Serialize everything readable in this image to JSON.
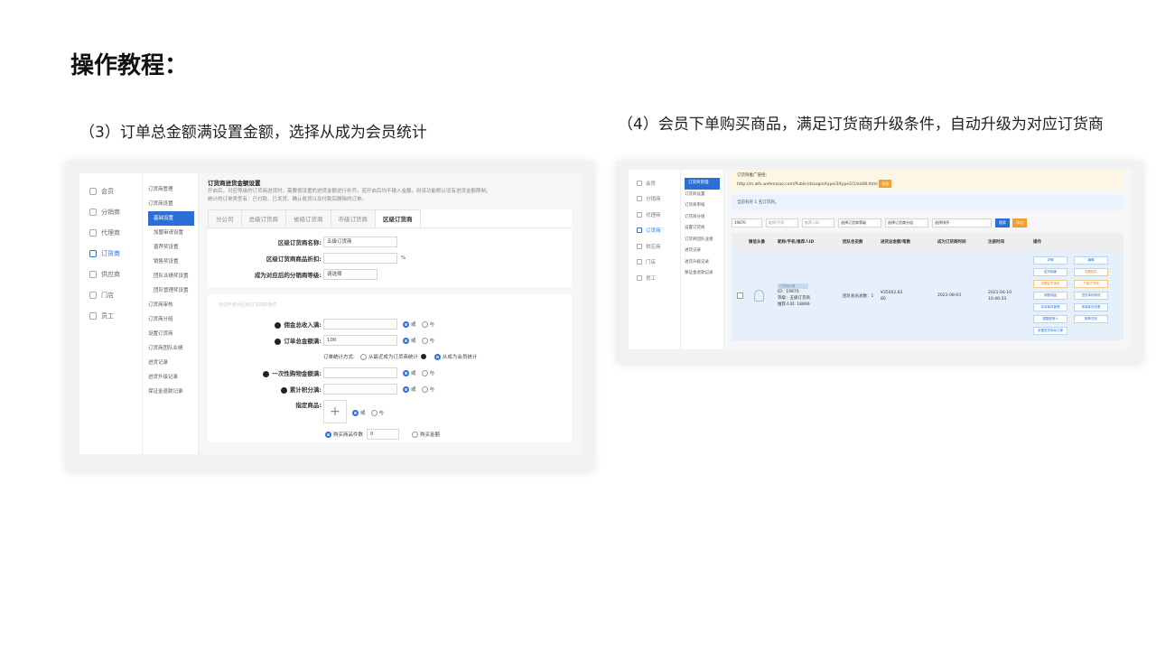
{
  "heading": "操作教程：",
  "captions": {
    "left": "（3）订单总金额满设置金额，选择从成为会员统计",
    "right": "（4）会员下单购买商品，满足订货商升级条件，自动升级为对应订货商"
  },
  "left_shot": {
    "sidebar": [
      "会员",
      "分销商",
      "代理商",
      "订货商",
      "供应商",
      "门店",
      "员工"
    ],
    "submenu": [
      "订货商管理",
      "订货商设置",
      "基础设置",
      "加盟审请设置",
      "晋荐奖设置",
      "销售奖设置",
      "团队业绩奖设置",
      "团队管理奖设置",
      "订货商审核",
      "订货商分组",
      "设置订货商",
      "订货商团队业绩",
      "进货记录",
      "进货升级记录",
      "保证金退款记录"
    ],
    "header_title": "订货商进货金额设置",
    "header_desc_1": "开启后，对应等级的订货商进货时，需要按设置的进货金额进行补齐。若开启后均不输入金额，则该功能默认没有进货金额限制。",
    "header_desc_2": "统计的订单类型有：已付款、已发货、确认收货以及付款后删除的订单。",
    "tabs": [
      "分公司",
      "总级订货商",
      "省级订货商",
      "市级订货商",
      "区级订货商"
    ],
    "fields": {
      "name_label": "区级订货商名称:",
      "name_value": "五级订货商",
      "discount_label": "区级订货商商品折扣:",
      "discount_unit": "%",
      "level_label": "成为对应后的分销商等级:",
      "level_value": "请选择",
      "faint_text": "自动升级为区级订货商的条件",
      "commission_label": "佣金总收入满:",
      "order_total_label": "订单总金额满:",
      "order_total_value": "100",
      "or": "或",
      "and": "与",
      "stat_method_label": "订单统计方式:",
      "stat_opt_1": "从最近成为订货商统计",
      "stat_opt_2": "从成为会员统计",
      "one_time_label": "一次性购物金额满:",
      "points_label": "累计积分满:",
      "goods_label": "指定商品:",
      "buy_count_label": "购买商品件数",
      "buy_count_value": "0",
      "buy_amount_label": "购买金额"
    }
  },
  "right_shot": {
    "sidebar": [
      "会员",
      "分销商",
      "代理商",
      "订货商",
      "供应商",
      "门店",
      "员工"
    ],
    "submenu": [
      "订货商管理",
      "订货商设置",
      "订货商审核",
      "订货商分组",
      "设置订货商",
      "订货商团队业绩",
      "进货记录",
      "进货升级记录",
      "保证金退款记录"
    ],
    "notice_line1": "订货商推广链接：",
    "notice_url": "http://m.wfx.wxfenxiao.com/Public/dsLogin/type/3/type2/1/aid/8.html",
    "notice_btn": "复制",
    "count_text": "当前有符 1 名订货商。",
    "filters": [
      "19870",
      "昵称/手机",
      "推荐人ID",
      "选择订货商等级",
      "选择订货商分组",
      "选择排序"
    ],
    "search_btn": "搜索",
    "export_btn": "导出",
    "columns": [
      "微信头像",
      "昵称/手机/推荐人ID",
      "团队会员数",
      "进货总金额/笔数",
      "成为订货商时间",
      "注册时间",
      "操作"
    ],
    "row": {
      "tag": "订货商分组",
      "id": "ID：19870",
      "level": "等级：五级订货商",
      "referrer": "推荐人ID: 18896",
      "team": "团队会员总数：1",
      "amount": "¥35002.62",
      "count": "80",
      "became": "2021-08-03",
      "reg_date": "2021-04-10",
      "reg_time": "10:46:33"
    },
    "ops": [
      "详情",
      "编辑",
      "进货明细",
      "查看团队",
      "设置会员身份",
      "下级订货商",
      "调整佣金",
      "进货库存修改",
      "实体库存管理",
      "商城库存查看",
      "调整推荐人",
      "推荐关系",
      "设置进货库存订单"
    ]
  }
}
